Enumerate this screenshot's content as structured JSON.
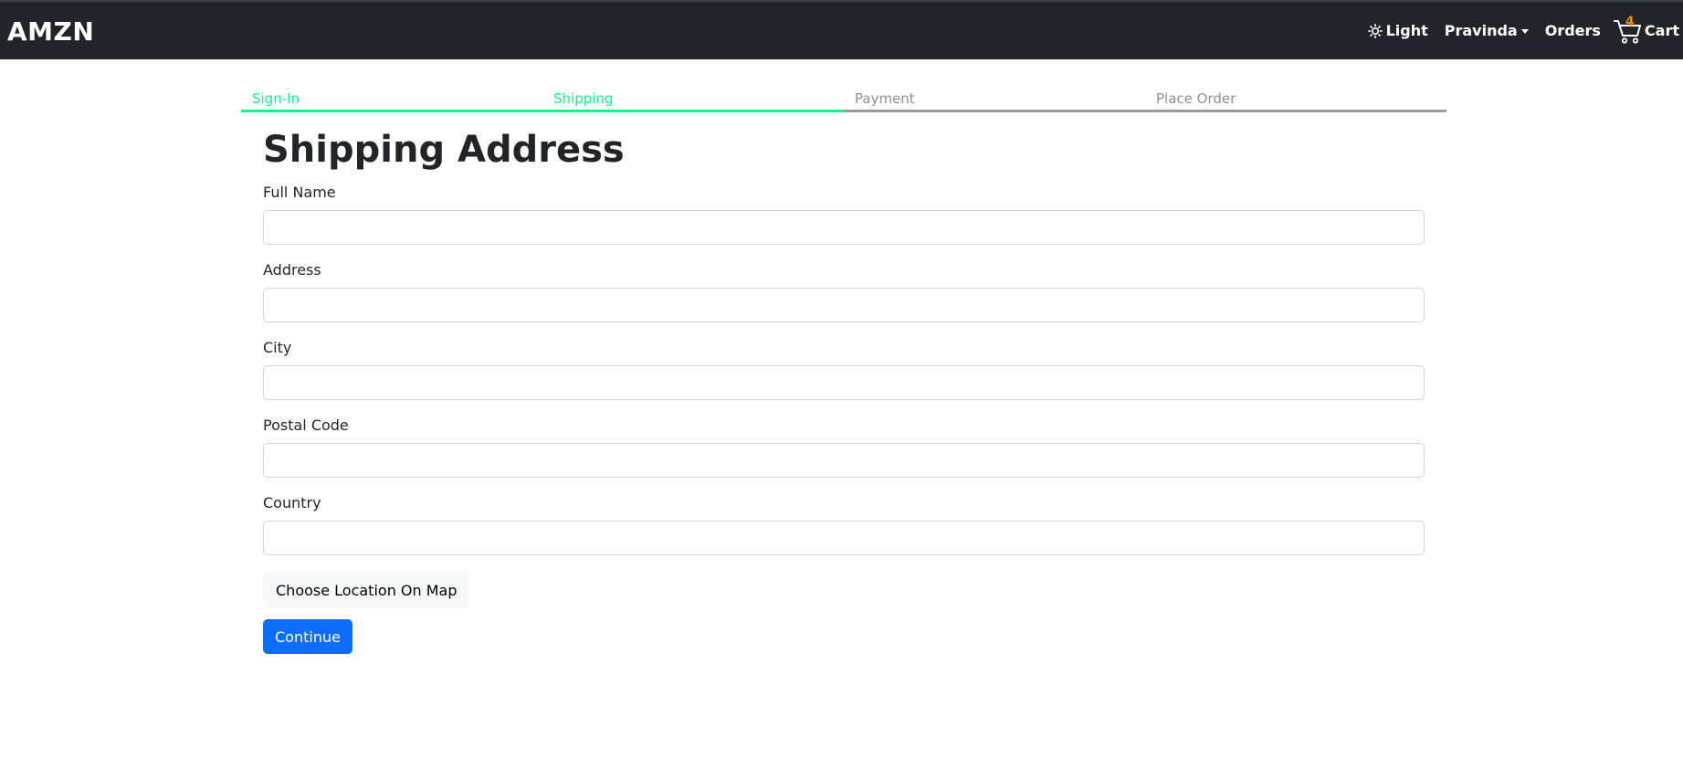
{
  "navbar": {
    "brand": "AMZN",
    "theme_label": "Light",
    "theme_icon": "sun-icon",
    "user_name": "Pravinda",
    "orders_label": "Orders",
    "cart_label": "Cart",
    "cart_count": "4",
    "background_color": "#212529",
    "cart_badge_color": "#f08804"
  },
  "steps": [
    {
      "label": "Sign-In",
      "active": true
    },
    {
      "label": "Shipping",
      "active": true
    },
    {
      "label": "Payment",
      "active": false
    },
    {
      "label": "Place Order",
      "active": false
    }
  ],
  "steps_active_color": "#0df58b",
  "form": {
    "title": "Shipping Address",
    "fields": [
      {
        "label": "Full Name",
        "value": ""
      },
      {
        "label": "Address",
        "value": ""
      },
      {
        "label": "City",
        "value": ""
      },
      {
        "label": "Postal Code",
        "value": ""
      },
      {
        "label": "Country",
        "value": ""
      }
    ],
    "map_button_label": "Choose Location On Map",
    "continue_button_label": "Continue",
    "continue_button_color": "#0d6efd"
  }
}
